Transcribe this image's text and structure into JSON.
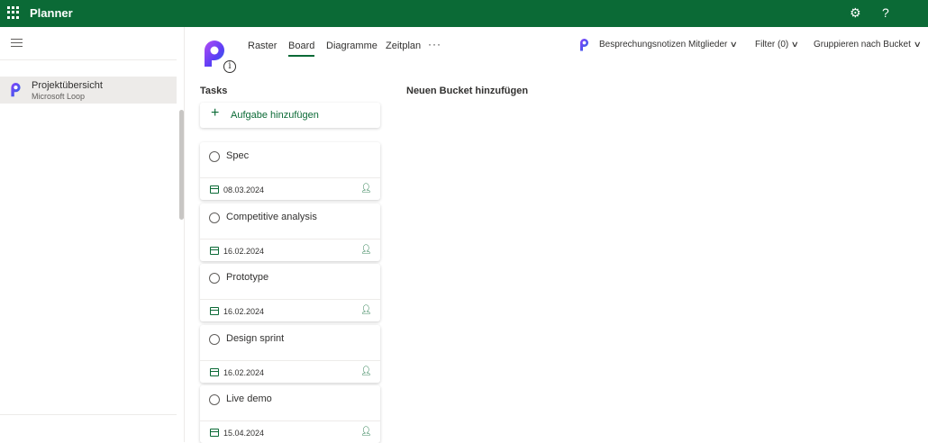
{
  "header": {
    "app_title": "Planner"
  },
  "sidebar": {
    "items": [
      {
        "title": "Projektübersicht",
        "subtitle": "Microsoft Loop"
      }
    ]
  },
  "tabs": [
    "Raster",
    "Board",
    "Diagramme",
    "Zeitplan"
  ],
  "active_tab": "Board",
  "toolbar": {
    "meeting_notes": "Besprechungsnotizen",
    "members": "Mitglieder",
    "filter": "Filter (0)",
    "group_by": "Gruppieren nach Bucket"
  },
  "board": {
    "bucket_title": "Tasks",
    "add_task_label": "Aufgabe hinzufügen",
    "add_bucket_label": "Neuen Bucket hinzufügen",
    "tasks": [
      {
        "title": "Spec",
        "due": "08.03.2024"
      },
      {
        "title": "Competitive analysis",
        "due": "16.02.2024"
      },
      {
        "title": "Prototype",
        "due": "16.02.2024"
      },
      {
        "title": "Design sprint",
        "due": "16.02.2024"
      },
      {
        "title": "Live demo",
        "due": "15.04.2024"
      }
    ]
  },
  "colors": {
    "brand": "#0b6a36",
    "accent": "#0b6a36"
  },
  "icons": [
    "waffle-icon",
    "settings-icon",
    "help-icon",
    "hamburger-icon",
    "loop-logo-icon",
    "info-icon",
    "more-icon",
    "chevron-down-icon",
    "plus-icon",
    "radio-circle-icon",
    "calendar-icon",
    "assign-user-icon"
  ]
}
